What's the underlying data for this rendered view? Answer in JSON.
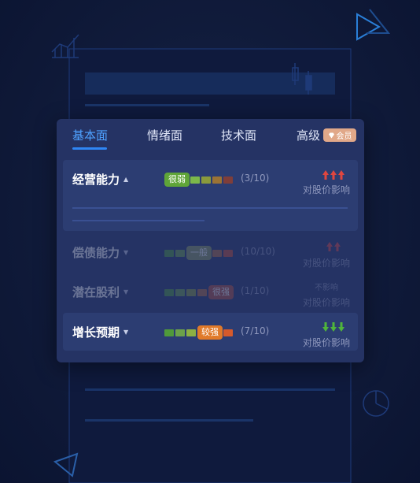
{
  "tabs": [
    {
      "label": "基本面",
      "active": true
    },
    {
      "label": "情绪面",
      "active": false
    },
    {
      "label": "技术面",
      "active": false
    },
    {
      "label": "高级",
      "active": false
    }
  ],
  "vip_badge": {
    "label": "会员",
    "icon": "diamond-icon"
  },
  "colors": {
    "accent": "#2f86f4",
    "weak": "#5fa538",
    "average": "#7a8a3c",
    "strong": "#d55a2c",
    "rise_arrow": "#e0463f",
    "fall_arrow": "#4fb53a"
  },
  "rows": [
    {
      "label": "经营能力",
      "expanded": true,
      "level_label": "很弱",
      "score": "(3/10)",
      "impact_label": "对股价影响",
      "impact_top": "",
      "impact_direction": "up"
    },
    {
      "label": "偿债能力",
      "expanded": false,
      "level_label": "一般",
      "score": "(10/10)",
      "impact_label": "对股价影响",
      "impact_top": "",
      "impact_direction": "up"
    },
    {
      "label": "潜在股利",
      "expanded": false,
      "level_label": "很强",
      "score": "(1/10)",
      "impact_label": "对股价影响",
      "impact_top": "不影响",
      "impact_direction": "none"
    },
    {
      "label": "增长预期",
      "expanded": false,
      "level_label": "较强",
      "score": "(7/10)",
      "impact_label": "对股价影响",
      "impact_top": "",
      "impact_direction": "down"
    }
  ]
}
